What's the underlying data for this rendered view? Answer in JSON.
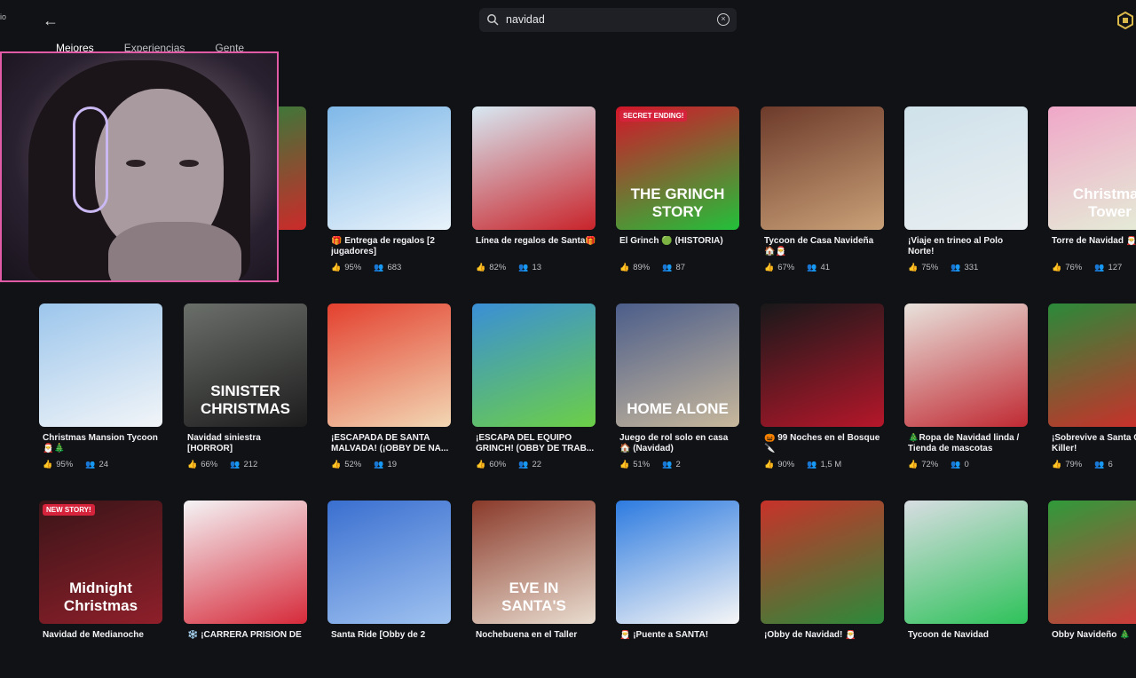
{
  "search": {
    "value": "navidad"
  },
  "tabs": [
    "Mejores",
    "Experiencias",
    "Gente"
  ],
  "left_edge_label": "io",
  "cards": [
    {
      "title": "",
      "like": "",
      "players": "",
      "thumb_text": "",
      "colors": [
        "#1b8a3d",
        "#cc2a2a"
      ],
      "badge": ""
    },
    {
      "title": "🎁 Entrega de regalos [2 jugadores]",
      "like": "95%",
      "players": "683",
      "thumb_text": "",
      "colors": [
        "#7fb8e8",
        "#e9f3fb"
      ],
      "badge": ""
    },
    {
      "title": "Línea de regalos de Santa🎁",
      "like": "82%",
      "players": "13",
      "thumb_text": "",
      "colors": [
        "#d7e8f2",
        "#c9232a"
      ],
      "badge": ""
    },
    {
      "title": "El Grinch 🟢 (HISTORIA)",
      "like": "89%",
      "players": "87",
      "thumb_text": "THE GRINCH STORY",
      "colors": [
        "#d4152a",
        "#22c03a"
      ],
      "badge": "SECRET ENDING!"
    },
    {
      "title": "Tycoon de Casa Navideña 🏠🎅",
      "like": "67%",
      "players": "41",
      "thumb_text": "",
      "colors": [
        "#6d3a2a",
        "#c9a178"
      ],
      "badge": ""
    },
    {
      "title": "¡Viaje en trineo al Polo Norte!",
      "like": "75%",
      "players": "331",
      "thumb_text": "",
      "colors": [
        "#cfe1ea",
        "#e9eff2"
      ],
      "badge": ""
    },
    {
      "title": "Torre de Navidad 🎅",
      "like": "76%",
      "players": "127",
      "thumb_text": "Christmas Tower",
      "colors": [
        "#f0a7c8",
        "#e4f0d8"
      ],
      "badge": ""
    },
    {
      "title": "Christmas Mansion Tycoon 🎅🎄",
      "like": "95%",
      "players": "24",
      "thumb_text": "",
      "colors": [
        "#9cc6ec",
        "#f2f5f8"
      ],
      "badge": ""
    },
    {
      "title": "Navidad siniestra [HORROR]",
      "like": "66%",
      "players": "212",
      "thumb_text": "SINISTER CHRISTMAS",
      "colors": [
        "#6b6f6a",
        "#1c1c1c"
      ],
      "badge": ""
    },
    {
      "title": "¡ESCAPADA DE SANTA MALVADA! (¡OBBY DE NA...",
      "like": "52%",
      "players": "19",
      "thumb_text": "",
      "colors": [
        "#e3402e",
        "#f2d7b4"
      ],
      "badge": ""
    },
    {
      "title": "¡ESCAPA DEL EQUIPO GRINCH! (OBBY DE TRAB...",
      "like": "60%",
      "players": "22",
      "thumb_text": "",
      "colors": [
        "#3a8fd6",
        "#6ccf46"
      ],
      "badge": ""
    },
    {
      "title": "Juego de rol solo en casa 🏠 (Navidad)",
      "like": "51%",
      "players": "2",
      "thumb_text": "HOME ALONE",
      "colors": [
        "#4b5d8a",
        "#c8b89c"
      ],
      "badge": ""
    },
    {
      "title": "🎃 99 Noches en el Bosque 🔪",
      "like": "90%",
      "players": "1,5 M",
      "thumb_text": "",
      "colors": [
        "#18181a",
        "#b5172a"
      ],
      "badge": ""
    },
    {
      "title": "🎄Ropa de Navidad linda / Tienda de mascotas",
      "like": "72%",
      "players": "0",
      "thumb_text": "",
      "colors": [
        "#e8e2dc",
        "#c02a33"
      ],
      "badge": ""
    },
    {
      "title": "¡Sobrevive a Santa C The Killer!",
      "like": "79%",
      "players": "6",
      "thumb_text": "",
      "colors": [
        "#2a8a3a",
        "#d42a2a"
      ],
      "badge": ""
    },
    {
      "title": "Navidad de Medianoche",
      "like": "",
      "players": "",
      "thumb_text": "Midnight Christmas",
      "colors": [
        "#3a1518",
        "#8e1f2a"
      ],
      "badge": "NEW STORY!"
    },
    {
      "title": "❄️ ¡CARRERA PRISIÓN DE",
      "like": "",
      "players": "",
      "thumb_text": "",
      "colors": [
        "#f4f4f6",
        "#d62a3a"
      ],
      "badge": ""
    },
    {
      "title": "Santa Ride [Obby de 2",
      "like": "",
      "players": "",
      "thumb_text": "",
      "colors": [
        "#3a6fd0",
        "#9fc2f0"
      ],
      "badge": ""
    },
    {
      "title": "Nochebuena en el Taller",
      "like": "",
      "players": "",
      "thumb_text": "EVE IN SANTA'S",
      "colors": [
        "#8a3a2a",
        "#e9ddd0"
      ],
      "badge": ""
    },
    {
      "title": "🎅 ¡Puente a SANTA!",
      "like": "",
      "players": "",
      "thumb_text": "",
      "colors": [
        "#2d7be0",
        "#f6f6f6"
      ],
      "badge": ""
    },
    {
      "title": "¡Obby de Navidad! 🎅",
      "like": "",
      "players": "",
      "thumb_text": "",
      "colors": [
        "#c8322a",
        "#2b8a3a"
      ],
      "badge": ""
    },
    {
      "title": "Tycoon de Navidad",
      "like": "",
      "players": "",
      "thumb_text": "",
      "colors": [
        "#d8dde2",
        "#2ec25a"
      ],
      "badge": ""
    },
    {
      "title": "Obby Navideño 🎄",
      "like": "",
      "players": "",
      "thumb_text": "",
      "colors": [
        "#2f9a3a",
        "#d9343a"
      ],
      "badge": ""
    }
  ]
}
